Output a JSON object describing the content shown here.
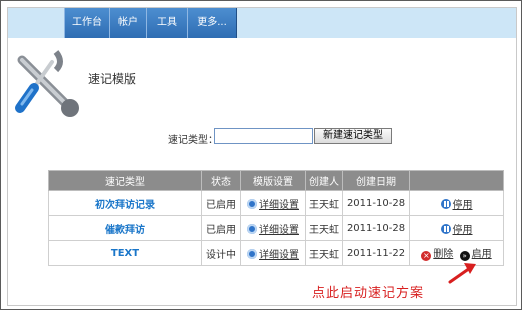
{
  "nav": {
    "tabs": [
      {
        "label": "工作台"
      },
      {
        "label": "帐户"
      },
      {
        "label": "工具"
      },
      {
        "label": "更多..."
      }
    ]
  },
  "page": {
    "title": "速记模版"
  },
  "search": {
    "label": "速记类型：",
    "value": "",
    "button_label": "新建速记类型"
  },
  "table": {
    "headers": [
      "速记类型",
      "状态",
      "模版设置",
      "创建人",
      "创建日期",
      ""
    ],
    "rows": [
      {
        "type": "初次拜访记录",
        "status": "已启用",
        "settings": "详细设置",
        "creator": "王天虹",
        "date": "2011-10-28",
        "action": "停用"
      },
      {
        "type": "催款拜访",
        "status": "已启用",
        "settings": "详细设置",
        "creator": "王天虹",
        "date": "2011-10-28",
        "action": "停用"
      },
      {
        "type": "TEXT",
        "status": "设计中",
        "settings": "详细设置",
        "creator": "王天虹",
        "date": "2011-11-22",
        "action_delete": "删除",
        "action_enable": "启用"
      }
    ]
  },
  "annotation": {
    "text": "点此启动速记方案"
  },
  "icons": {
    "logo": "wrench-screwdriver-icon",
    "settings": "settings-icon",
    "pause": "pause-icon",
    "delete": "delete-icon",
    "enable": "enable-icon",
    "arrow": "red-arrow-icon"
  },
  "colors": {
    "tab_blue": "#3a7cc3",
    "topbar": "#cde6f7",
    "link_blue": "#1a76c9",
    "header_gray": "#8c8c8c",
    "annotation_red": "#d81f1f"
  }
}
